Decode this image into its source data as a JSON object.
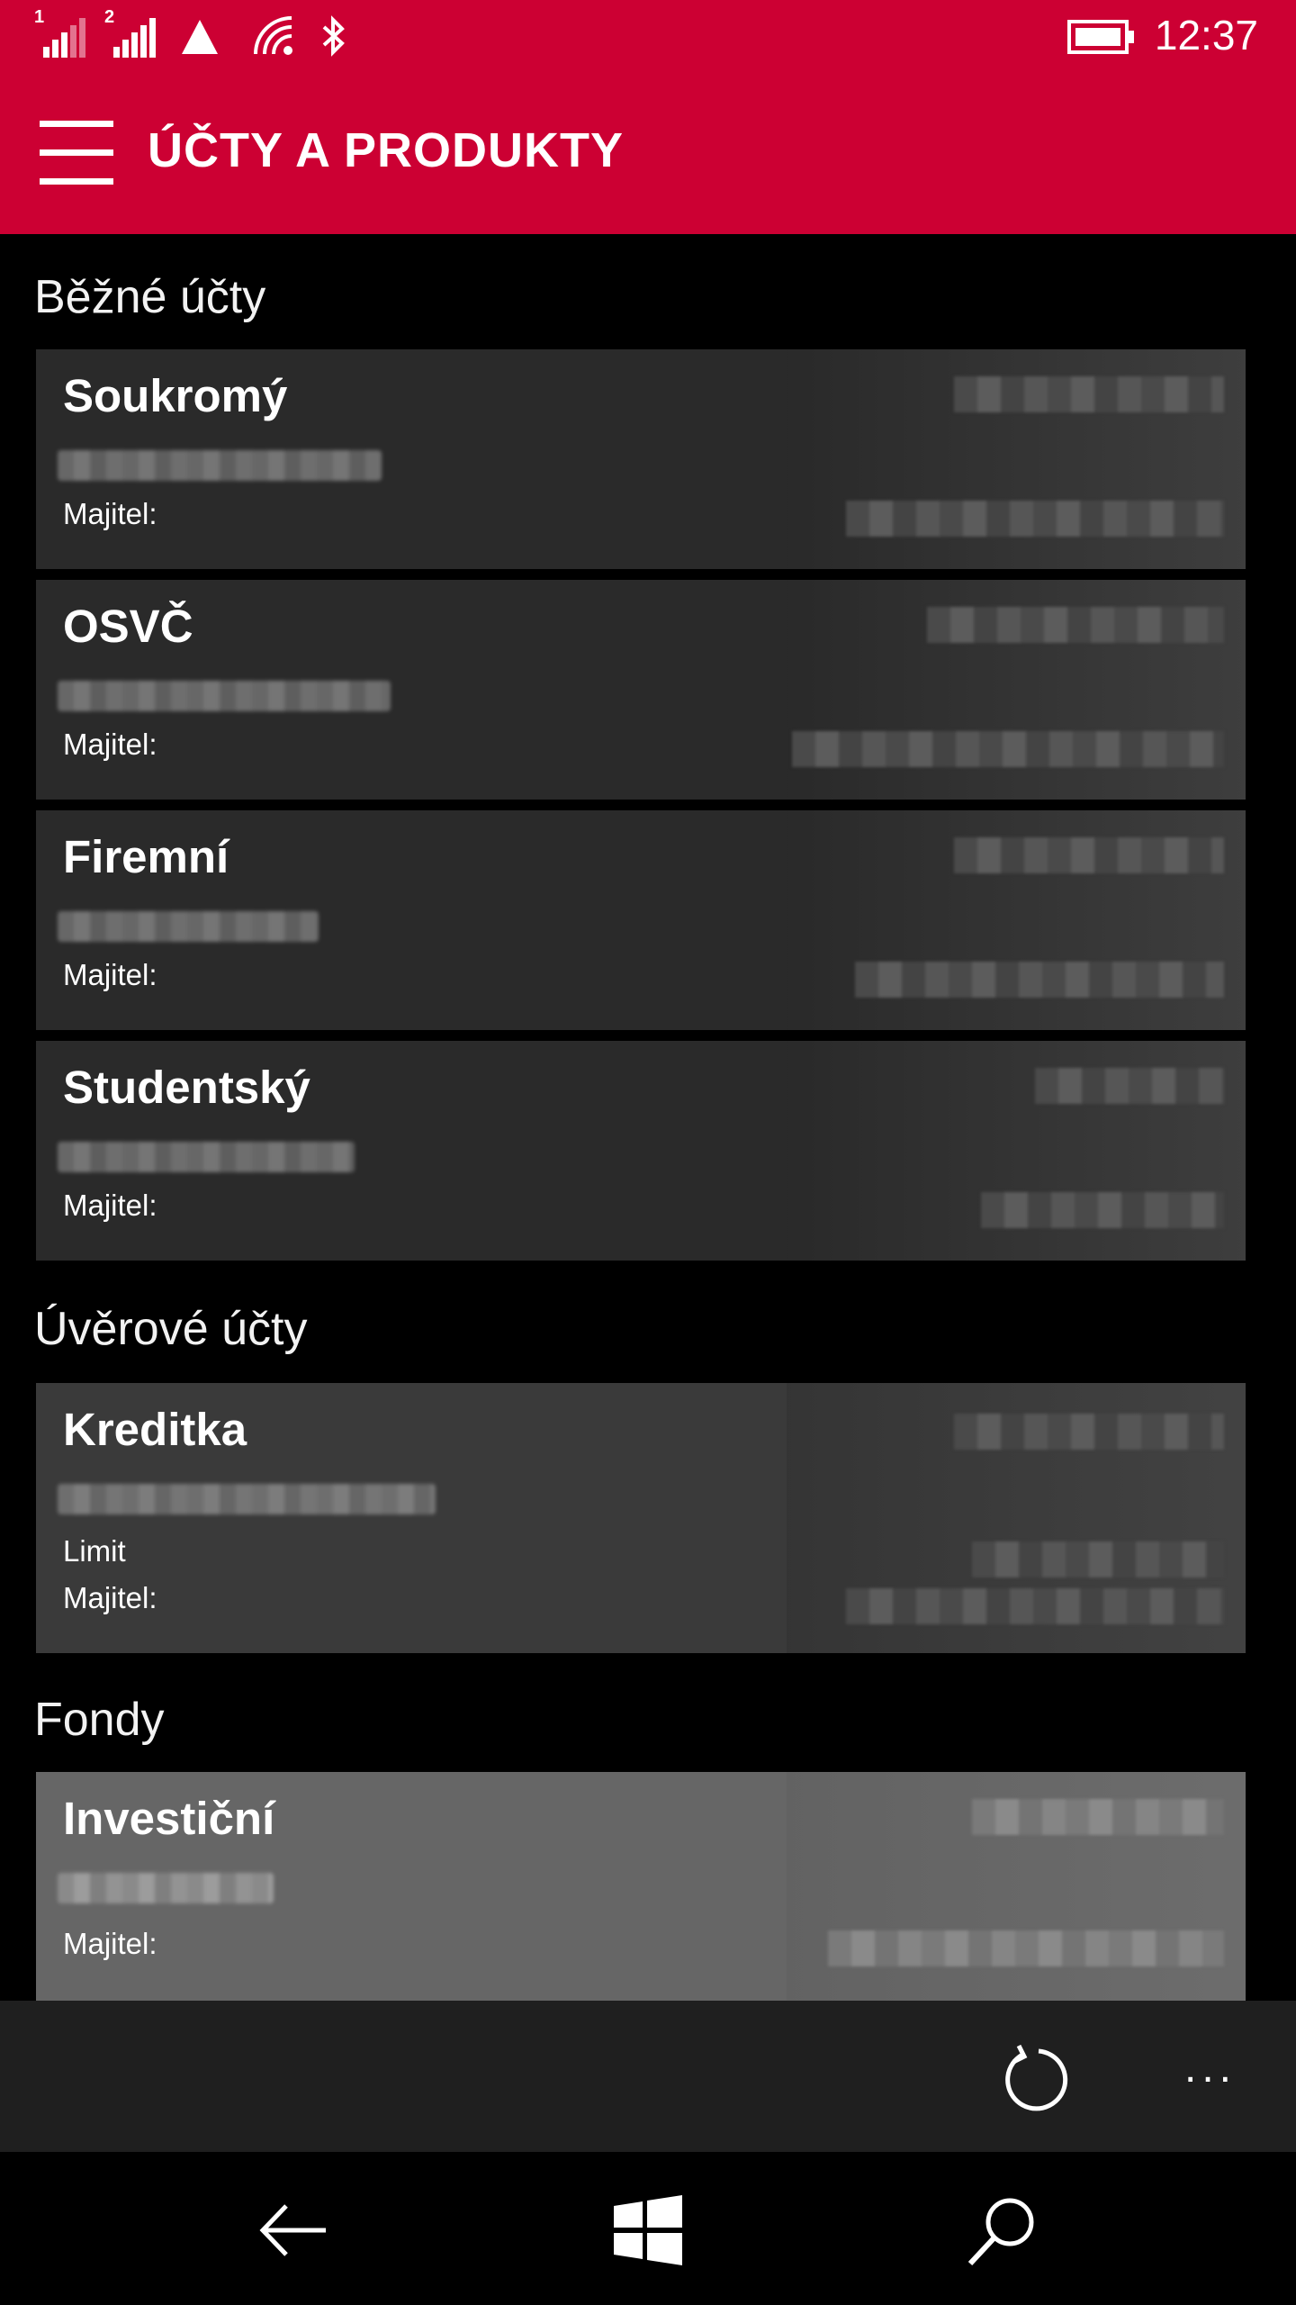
{
  "status_bar": {
    "sim1_label": "1",
    "sim2_label": "2",
    "time": "12:37",
    "icons": [
      "signal-sim1-icon",
      "signal-sim2-icon",
      "data-triangle-icon",
      "wifi-icon",
      "bluetooth-icon",
      "battery-icon"
    ]
  },
  "header": {
    "title": "ÚČTY A PRODUKTY",
    "menu_icon": "hamburger-menu-icon",
    "accent_color": "#cc0033"
  },
  "sections": [
    {
      "title": "Běžné účty",
      "accounts": [
        {
          "name": "Soukromý",
          "owner_label": "Majitel:"
        },
        {
          "name": "OSVČ",
          "owner_label": "Majitel:"
        },
        {
          "name": "Firemní",
          "owner_label": "Majitel:"
        },
        {
          "name": "Studentský",
          "owner_label": "Majitel:"
        }
      ]
    },
    {
      "title": "Úvěrové účty",
      "accounts": [
        {
          "name": "Kreditka",
          "limit_label": "Limit",
          "owner_label": "Majitel:"
        }
      ]
    },
    {
      "title": "Fondy",
      "accounts": [
        {
          "name": "Investiční",
          "owner_label": "Majitel:"
        }
      ]
    }
  ],
  "app_bar": {
    "refresh_icon": "refresh-icon",
    "more_label": "..."
  },
  "nav_bar": {
    "icons": [
      "back-arrow-icon",
      "windows-start-icon",
      "search-icon"
    ]
  }
}
